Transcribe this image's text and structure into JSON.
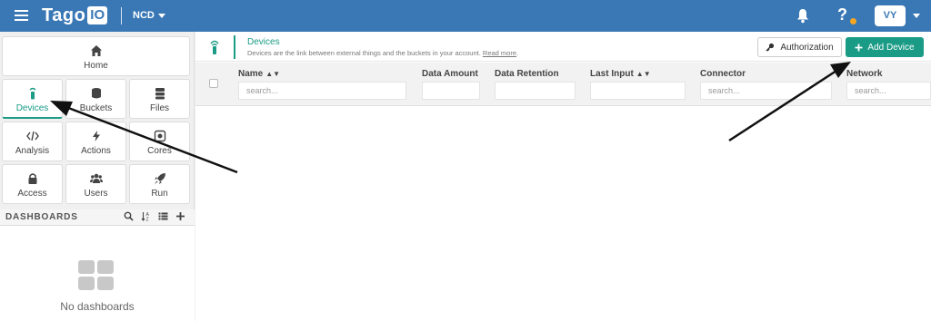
{
  "topbar": {
    "logo_text": "Tago",
    "logo_io": "IO",
    "profile_name": "NCD",
    "help_label": "?",
    "avatar_initials": "VY"
  },
  "sidebar": {
    "tiles": [
      {
        "label": "Home",
        "icon": "home-icon"
      },
      {
        "label": "Devices",
        "icon": "device-icon",
        "active": true
      },
      {
        "label": "Buckets",
        "icon": "bucket-icon"
      },
      {
        "label": "Files",
        "icon": "files-icon"
      },
      {
        "label": "Analysis",
        "icon": "code-icon"
      },
      {
        "label": "Actions",
        "icon": "bolt-icon"
      },
      {
        "label": "Cores",
        "icon": "core-icon"
      },
      {
        "label": "Access",
        "icon": "lock-icon"
      },
      {
        "label": "Users",
        "icon": "users-icon"
      },
      {
        "label": "Run",
        "icon": "rocket-icon"
      }
    ],
    "dashboards": {
      "title": "DASHBOARDS",
      "empty_text": "No dashboards"
    }
  },
  "page": {
    "title": "Devices",
    "description": "Devices are the link between external things and the buckets in your account.",
    "read_more": "Read more",
    "buttons": {
      "authorization": "Authorization",
      "add_device": "Add Device"
    }
  },
  "table": {
    "columns": [
      {
        "label": "Name",
        "sortable": true,
        "filter_placeholder": "search..."
      },
      {
        "label": "Data Amount",
        "sortable": false,
        "filter_placeholder": ""
      },
      {
        "label": "Data Retention",
        "sortable": false,
        "filter_placeholder": ""
      },
      {
        "label": "Last Input",
        "sortable": true,
        "filter_placeholder": ""
      },
      {
        "label": "Connector",
        "sortable": false,
        "filter_placeholder": "search..."
      },
      {
        "label": "Network",
        "sortable": false,
        "filter_placeholder": "search..."
      }
    ]
  },
  "colors": {
    "topbar": "#3a78b5",
    "accent": "#1a9b86",
    "notification_dot": "#f5a623",
    "annotation_arrow": "#111111"
  }
}
